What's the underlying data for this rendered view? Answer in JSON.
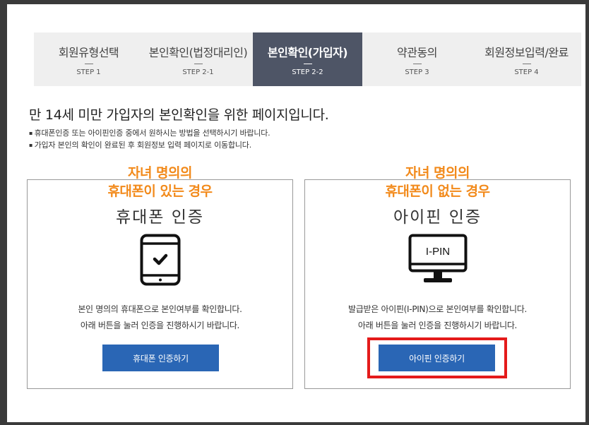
{
  "steps": [
    {
      "title": "회원유형선택",
      "step": "STEP 1",
      "active": false
    },
    {
      "title": "본인확인(법정대리인)",
      "step": "STEP 2-1",
      "active": false
    },
    {
      "title": "본인확인(가입자)",
      "step": "STEP 2-2",
      "active": true
    },
    {
      "title": "약관동의",
      "step": "STEP 3",
      "active": false
    },
    {
      "title": "회원정보입력/완료",
      "step": "STEP 4",
      "active": false
    }
  ],
  "heading": "만 14세 미만 가입자의 본인확인을 위한 페이지입니다.",
  "notes": [
    "휴대폰인증 또는 아이핀인증 중에서 원하시는 방법을 선택하시기 바랍니다.",
    "가입자 본인의 확인이 완료된 후 회원정보 입력 페이지로 이동합니다."
  ],
  "annotations": {
    "left": {
      "line1": "자녀 명의의",
      "line2": "휴대폰이 있는 경우"
    },
    "right": {
      "line1": "자녀 명의의",
      "line2": "휴대폰이 없는 경우"
    },
    "color": "#f28a1b"
  },
  "phone": {
    "title": "휴대폰 인증",
    "icon": "tablet-check-icon",
    "desc1": "본인 명의의 휴대폰으로 본인여부를 확인합니다.",
    "desc2": "아래 버튼을 눌러 인증을 진행하시기 바랍니다.",
    "button": "휴대폰 인증하기"
  },
  "ipin": {
    "title": "아이핀 인증",
    "icon": "monitor-ipin-icon",
    "icon_text": "I-PIN",
    "desc1": "발급받은 아이핀(I-PIN)으로 본인여부를 확인합니다.",
    "desc2": "아래 버튼을 눌러 인증을 진행하시기 바랍니다.",
    "button": "아이핀 인증하기"
  },
  "colors": {
    "active_step": "#4e5566",
    "button": "#2a66b5",
    "highlight": "#e41b1b"
  }
}
